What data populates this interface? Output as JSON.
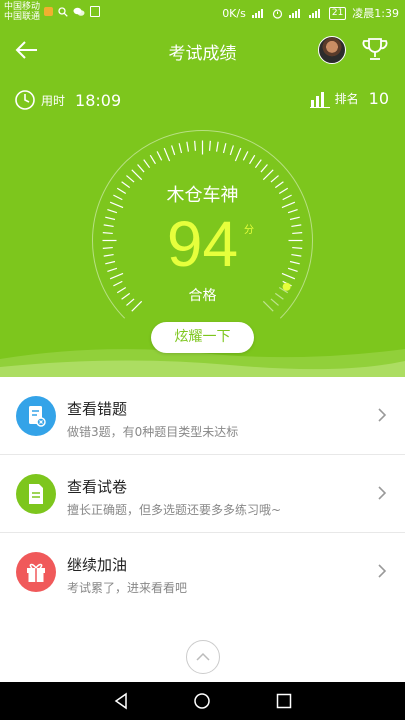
{
  "status_bar": {
    "carrier1": "中国移动",
    "carrier2": "中国联通",
    "speed": "0K/s",
    "battery": "21",
    "time": "凌晨1:39"
  },
  "header": {
    "title": "考试成绩",
    "back_icon": "back-arrow-icon",
    "trophy_icon": "trophy-icon"
  },
  "stats": {
    "time_label": "用时",
    "time_value": "18:09",
    "rank_label": "排名",
    "rank_value": "10"
  },
  "result": {
    "title": "木仓车神",
    "score": "94",
    "score_unit": "分",
    "status": "合格",
    "score_fraction": 0.94,
    "share_button": "炫耀一下"
  },
  "colors": {
    "brand": "#7dc61d",
    "score": "#e6ff3c",
    "blue": "#34a3e8",
    "green": "#7dc61d",
    "red": "#f0595a"
  },
  "menu": [
    {
      "title": "查看错题",
      "desc": "做错3题，有0种题目类型未达标",
      "icon": "wrong-questions-icon"
    },
    {
      "title": "查看试卷",
      "desc": "擅长正确题，但多选题还要多多练习哦~",
      "icon": "exam-paper-icon"
    },
    {
      "title": "继续加油",
      "desc": "考试累了，进来看看吧",
      "icon": "gift-icon"
    }
  ]
}
